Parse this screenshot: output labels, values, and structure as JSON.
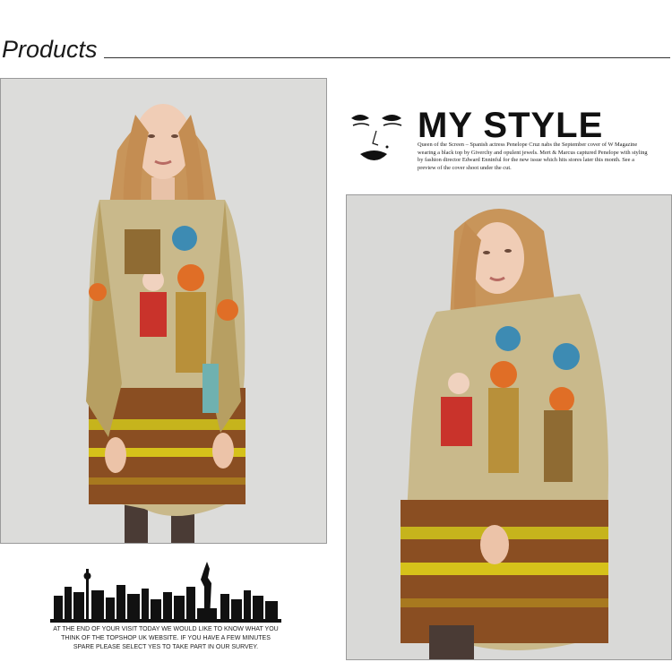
{
  "header": {
    "title": "Products"
  },
  "photos": [
    {
      "name": "model-photo-front"
    },
    {
      "name": "model-photo-side"
    }
  ],
  "promo": {
    "title": "MY STYLE",
    "text": "Queen of the Screen – Spanish actress Penelope Cruz nabs the September cover of W Magazine wearing a black top by Giverchy and opulent jewels. Mert & Marcus captured Penelope with styling by fashion director Edward Enninful for the new issue which hits stores later this month. See a preview of the cover shoot under the cut."
  },
  "footer": {
    "survey_text": "AT THE END OF YOUR VISIT TODAY WE WOULD LIKE TO KNOW WHAT YOU THINK OF THE TOPSHOP UK WEBSITE. IF YOU HAVE A FEW MINUTES SPARE PLEASE SELECT YES TO TAKE PART IN OUR SURVEY."
  },
  "colors": {
    "accent_red": "#c9332b",
    "accent_yellow": "#d6c21a",
    "accent_brown": "#8a4e22"
  }
}
